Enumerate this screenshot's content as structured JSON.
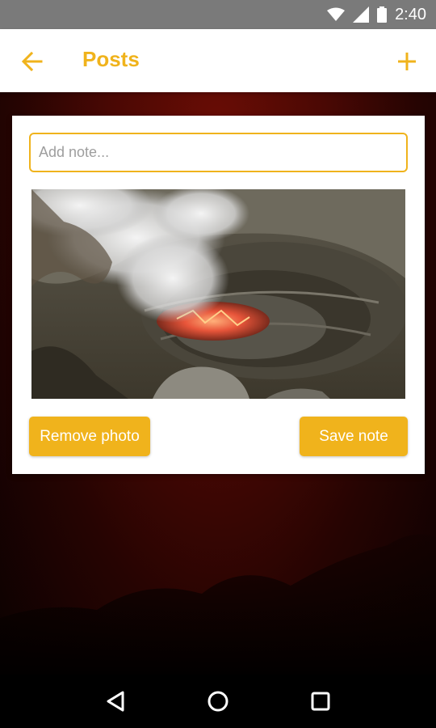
{
  "status_bar": {
    "time": "2:40",
    "icons": [
      "wifi-icon",
      "signal-icon",
      "battery-icon"
    ]
  },
  "app_bar": {
    "title": "Posts",
    "back_icon": "arrow-left-icon",
    "add_icon": "plus-icon"
  },
  "card": {
    "note_input": {
      "placeholder": "Add note...",
      "value": ""
    },
    "photo": {
      "subject": "volcano-crater-photo"
    },
    "buttons": {
      "remove_label": "Remove photo",
      "save_label": "Save note"
    }
  },
  "nav_bar": {
    "icons": [
      "back-triangle-icon",
      "home-circle-icon",
      "recents-square-icon"
    ]
  },
  "colors": {
    "accent": "#f0b31c",
    "status_bar": "#7a7a7a",
    "background_top": "#6b0d05",
    "background_bottom": "#0a0101"
  }
}
